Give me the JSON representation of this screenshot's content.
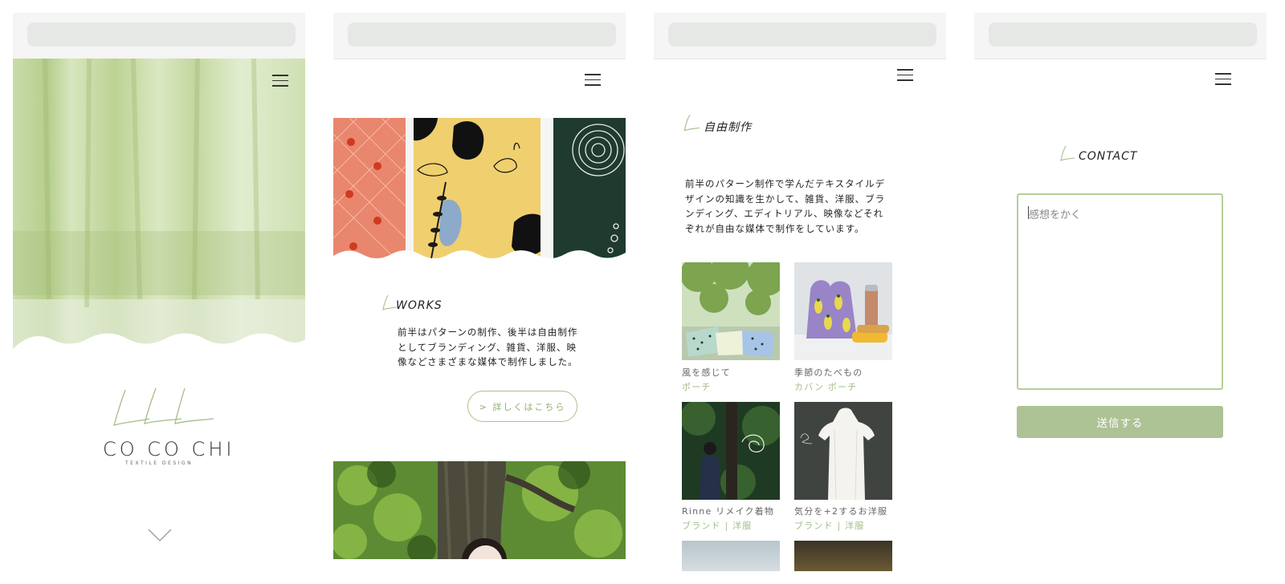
{
  "panel1": {
    "logo": {
      "main": "CO CO CHI",
      "sub": "TEXTILE DESIGN"
    },
    "icons": {
      "menu": "hamburger-menu-icon",
      "scroll": "chevron-down-icon"
    }
  },
  "panel2": {
    "works": {
      "title": "WORKS",
      "lines": [
        "前半はパターンの制作、後半は自由制作",
        "としてブランディング、雑貨、洋服、映",
        "像などさまざまな媒体で制作しました。"
      ],
      "button": "> 詳しくはこちら"
    }
  },
  "panel3": {
    "free": {
      "title": "自由制作",
      "lines": [
        "前半のパターン制作で学んだテキスタイルデ",
        "ザインの知識を生かして、雑貨、洋服、ブラ",
        "ンディング、エディトリアル、映像などそれ",
        "ぞれが自由な媒体で制作をしています。"
      ]
    },
    "items": [
      {
        "title": "風を感じて",
        "category": "ポーチ"
      },
      {
        "title": "季節のたべもの",
        "category": "カバン ポーチ"
      },
      {
        "title": "Rinne リメイク着物",
        "category": "ブランド | 洋服"
      },
      {
        "title": "気分を+2するお洋服",
        "category": "ブランド | 洋服"
      }
    ]
  },
  "panel4": {
    "contact": {
      "title": "CONTACT",
      "placeholder": "感想をかく",
      "send": "送信する"
    }
  },
  "colors": {
    "accent": "#adc295",
    "accent_text": "#a3bd87",
    "border": "#b5cf9b"
  }
}
